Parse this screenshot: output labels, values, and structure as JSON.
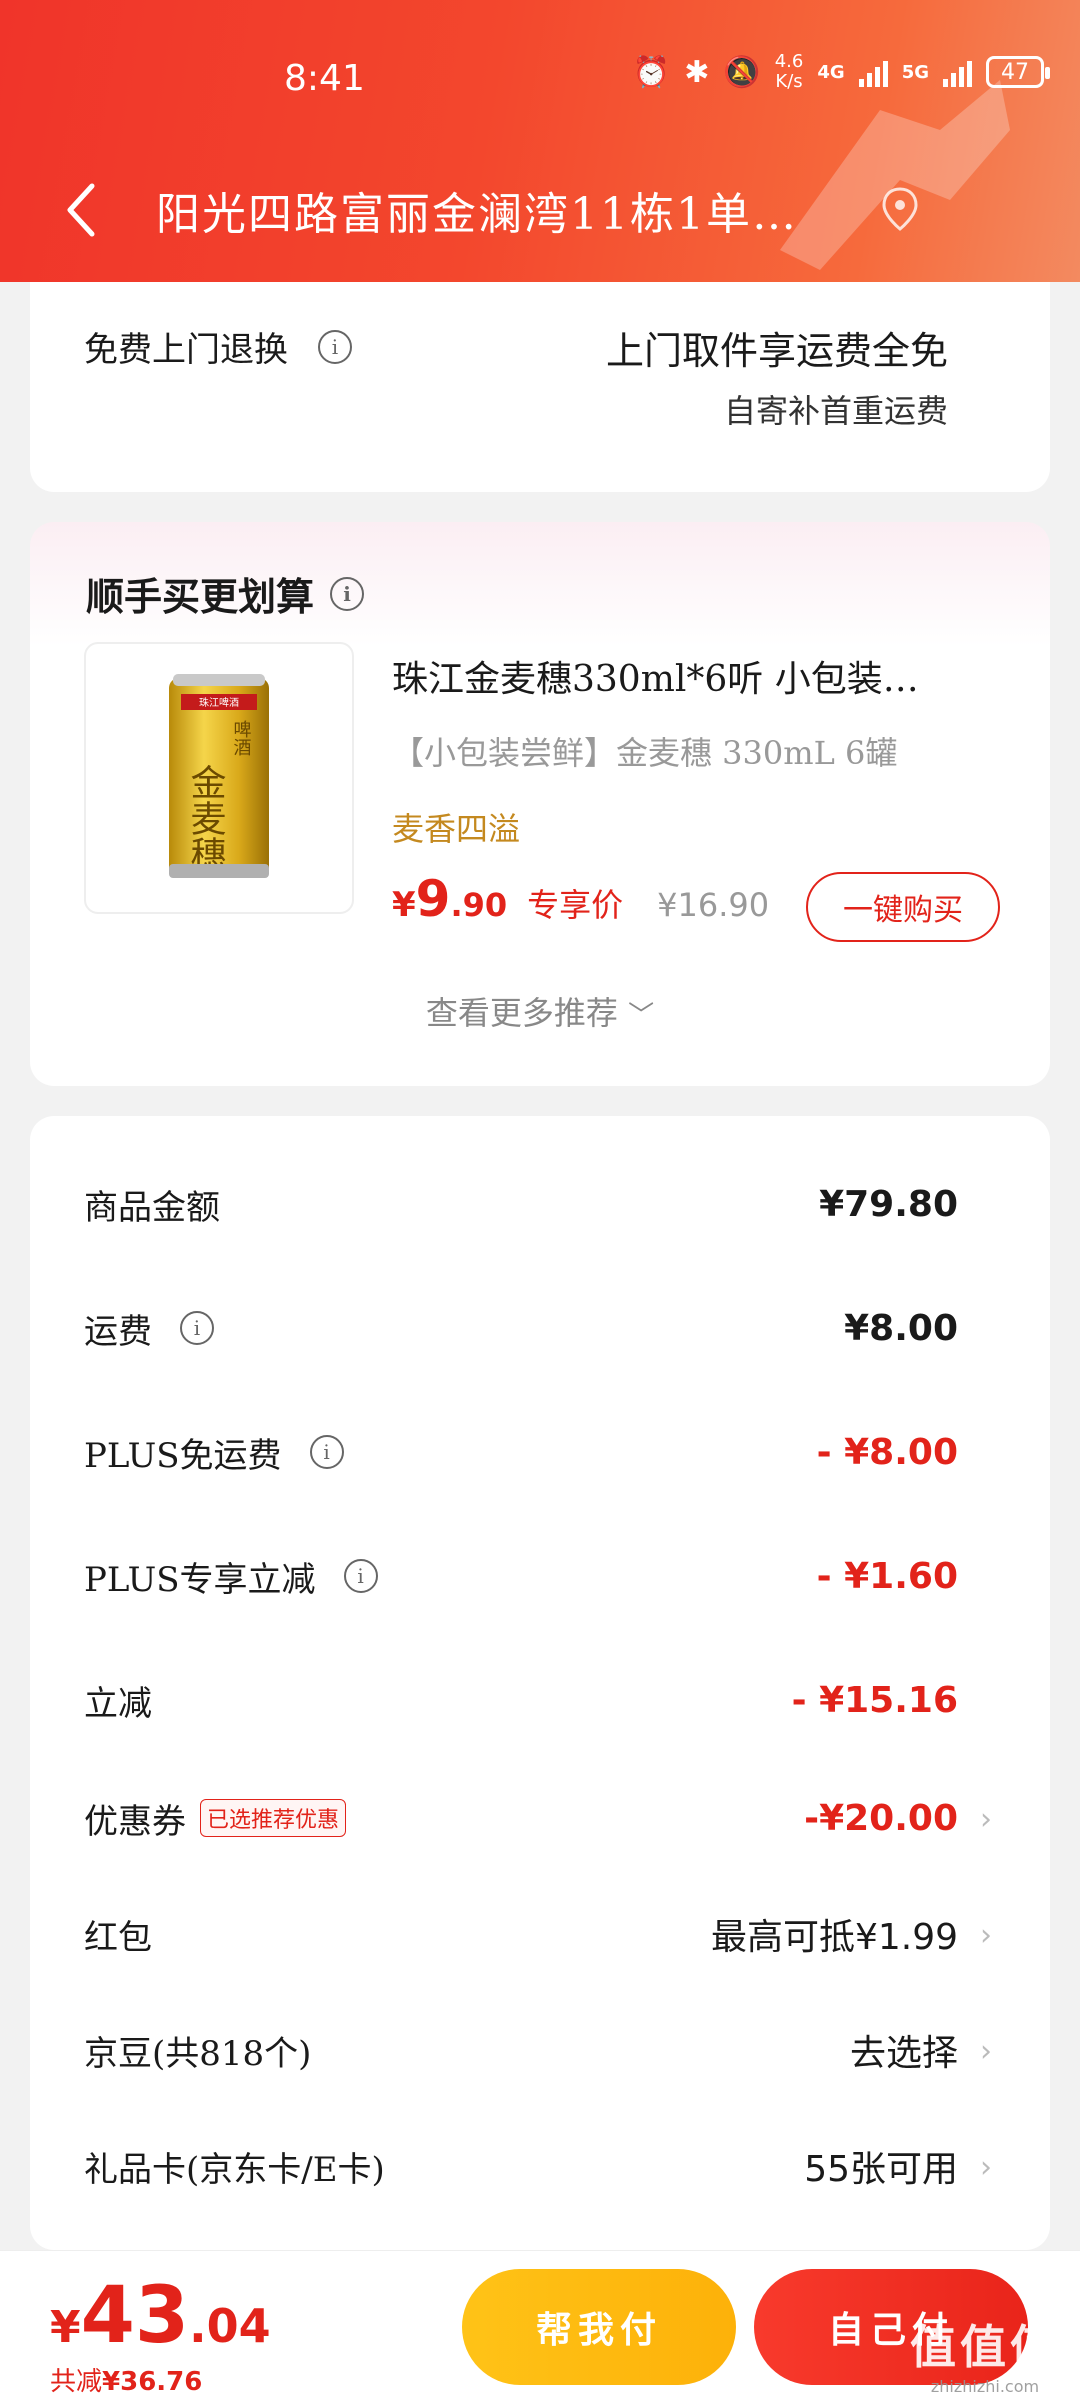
{
  "status_bar": {
    "time": "8:41",
    "speed_value": "4.6",
    "speed_unit": "K/s",
    "net1": "4G",
    "net2": "5G",
    "battery": "47"
  },
  "header": {
    "address": "阳光四路富丽金澜湾11栋1单…"
  },
  "return_section": {
    "label": "免费上门退换",
    "main": "上门取件享运费全免",
    "sub": "自寄补首重运费"
  },
  "recommend": {
    "title": "顺手买更划算",
    "product": {
      "name": "珠江金麦穗330ml*6听 小包装…",
      "desc": "【小包装尝鲜】金麦穗 330mL 6罐",
      "tag": "麦香四溢",
      "price_yen": "¥",
      "price_int": "9",
      "price_dec": ".90",
      "price_label": "专享价",
      "old_price": "¥16.90",
      "buy_label": "一键购买",
      "can_label_top": "珠江啤酒",
      "can_label_main": "金麦穗",
      "can_label_side": "啤酒"
    },
    "more_label": "查看更多推荐"
  },
  "summary": {
    "rows": [
      {
        "label": "商品金额",
        "value": "¥79.80"
      },
      {
        "label": "运费",
        "value": "¥8.00"
      },
      {
        "label": "PLUS免运费",
        "value": "- ¥8.00"
      },
      {
        "label": "PLUS专享立减",
        "value": "- ¥1.60"
      },
      {
        "label": "立减",
        "value": "- ¥15.16"
      },
      {
        "label": "优惠券",
        "tag": "已选推荐优惠",
        "value": "-¥20.00"
      },
      {
        "label": "红包",
        "value": "最高可抵¥1.99"
      },
      {
        "label": "京豆(共818个)",
        "value": "去选择"
      },
      {
        "label": "礼品卡(京东卡/E卡)",
        "value": "55张可用"
      }
    ]
  },
  "bottom": {
    "total_yen": "¥",
    "total_int": "43",
    "total_dec": ".04",
    "saved_label": "共减",
    "saved_value": "¥36.76",
    "help_label": "帮我付",
    "self_label": "自己付",
    "watermark": "值值值",
    "watermark_url": "zhizhizhi.com"
  },
  "colors": {
    "accent_red": "#e2231a",
    "header_start": "#f0342a",
    "gold_tag": "#c4891f",
    "help_btn": "#ffc317"
  }
}
